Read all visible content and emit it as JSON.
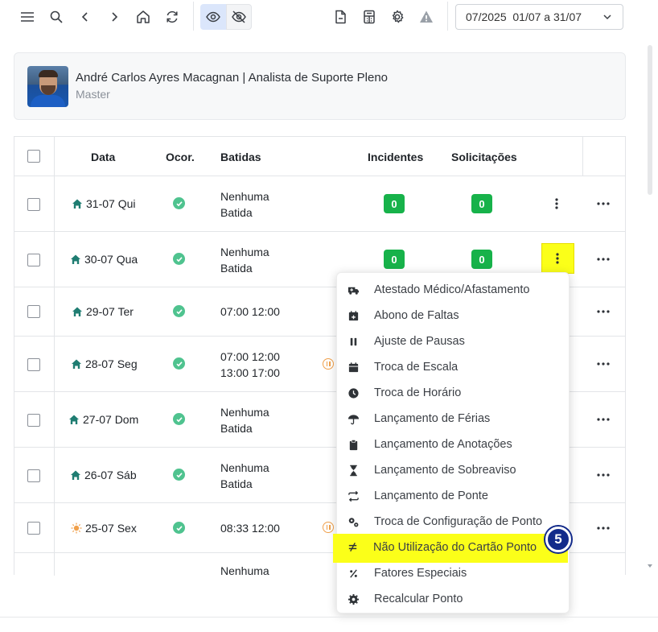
{
  "toolbar": {
    "icons": [
      "menu-icon",
      "search-icon",
      "chevron-left-icon",
      "chevron-right-icon",
      "home-icon",
      "refresh-icon",
      "eye-icon",
      "eye-off-icon",
      "document-icon",
      "calculator-icon",
      "gear-icon",
      "warning-icon"
    ],
    "period_value": "07/2025  01/07 a 31/07"
  },
  "profile": {
    "name": "André Carlos Ayres Macagnan | Analista de Suporte Pleno",
    "role": "Master"
  },
  "table": {
    "headers": {
      "date": "Data",
      "occurrence": "Ocor.",
      "punches": "Batidas",
      "incidents": "Incidentes",
      "requests": "Solicitações"
    },
    "rows": [
      {
        "date": "31-07 Qui",
        "icon": "home-icon",
        "punch1": "Nenhuma",
        "punch2": "Batida",
        "incidents": "0",
        "requests": "0"
      },
      {
        "date": "30-07 Qua",
        "icon": "home-icon",
        "punch1": "Nenhuma",
        "punch2": "Batida",
        "incidents": "0",
        "requests": "0"
      },
      {
        "date": "29-07 Ter",
        "icon": "home-icon",
        "punch1": "07:00 12:00",
        "punch2": ""
      },
      {
        "date": "28-07 Seg",
        "icon": "home-icon",
        "punch1": "07:00 12:00",
        "punch2": "13:00 17:00"
      },
      {
        "date": "27-07 Dom",
        "icon": "home-icon",
        "punch1": "Nenhuma",
        "punch2": "Batida"
      },
      {
        "date": "26-07 Sáb",
        "icon": "home-icon",
        "punch1": "Nenhuma",
        "punch2": "Batida"
      },
      {
        "date": "25-07 Sex",
        "icon": "sun-icon",
        "punch1": "08:33 12:00",
        "punch2": ""
      },
      {
        "punch1": "Nenhuma"
      }
    ]
  },
  "menu": {
    "items": [
      {
        "label": "Atestado Médico/Afastamento",
        "icon": "ambulance-icon"
      },
      {
        "label": "Abono de Faltas",
        "icon": "calendar-plus-icon"
      },
      {
        "label": "Ajuste de Pausas",
        "icon": "pause-icon"
      },
      {
        "label": "Troca de Escala",
        "icon": "calendar-icon"
      },
      {
        "label": "Troca de Horário",
        "icon": "clock-icon"
      },
      {
        "label": "Lançamento de Férias",
        "icon": "umbrella-icon"
      },
      {
        "label": "Lançamento de Anotações",
        "icon": "clipboard-icon"
      },
      {
        "label": "Lançamento de Sobreaviso",
        "icon": "hourglass-icon"
      },
      {
        "label": "Lançamento de Ponte",
        "icon": "swap-icon"
      },
      {
        "label": "Troca de Configuração de Ponto",
        "icon": "gears-icon"
      },
      {
        "label": "Não Utilização do Cartão Ponto",
        "icon": "not-equal-icon"
      },
      {
        "label": "Fatores Especiais",
        "icon": "percent-icon"
      },
      {
        "label": "Recalcular Ponto",
        "icon": "gear-icon"
      }
    ]
  },
  "step_marker": "5",
  "colors": {
    "highlight": "#fbff19",
    "badge_green": "#17b24a",
    "ok_green": "#4fc38f",
    "home_teal": "#1f7d72",
    "sun_orange": "#f0a04b",
    "step_blue": "#122a8a",
    "toggle_active": "#dbe6fb"
  }
}
